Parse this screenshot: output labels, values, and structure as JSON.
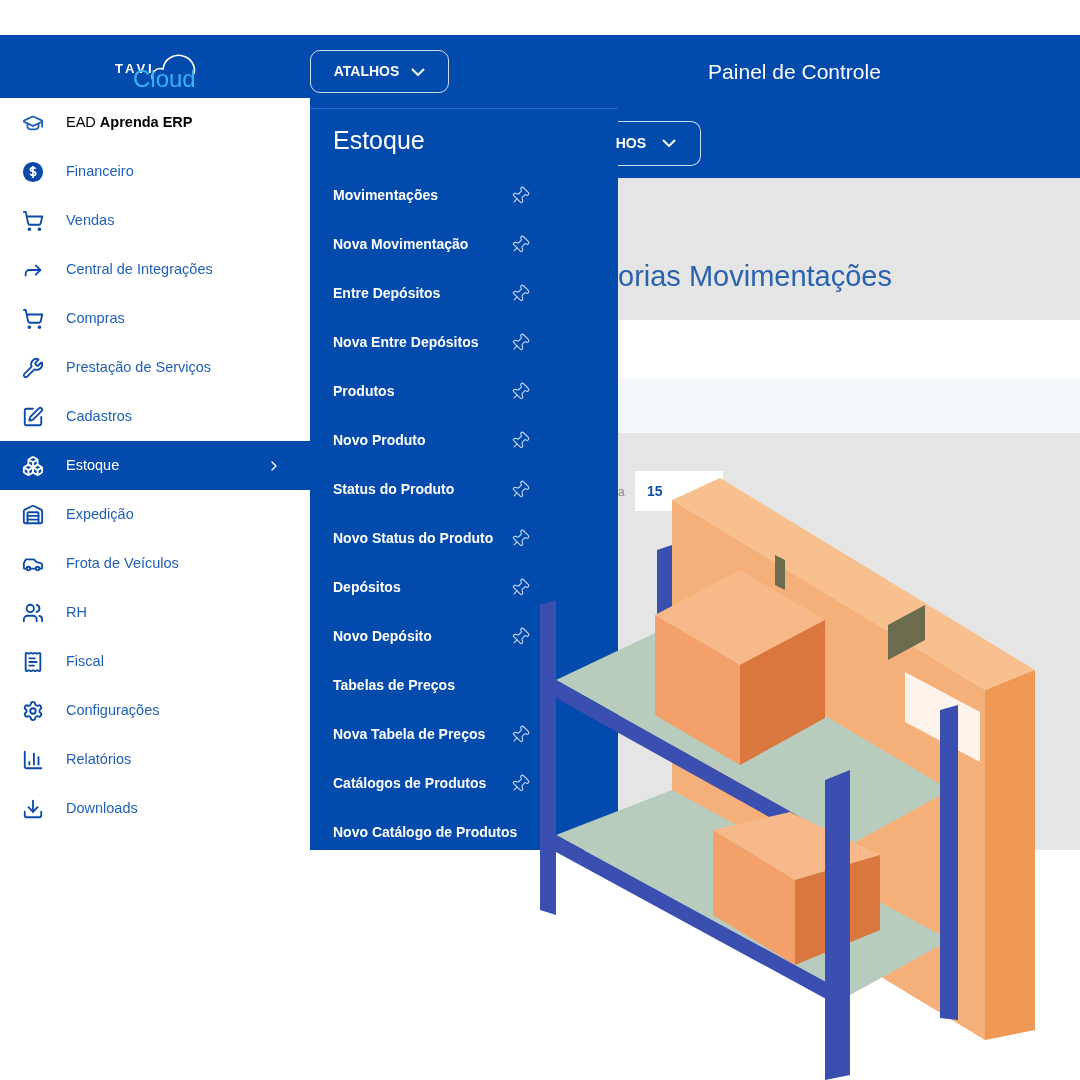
{
  "header": {
    "logo": {
      "top": "TAVI",
      "bottom": "Cloud"
    },
    "shortcuts_button": "ATALHOS",
    "title": "Painel de Controle"
  },
  "sidebar": {
    "items": [
      {
        "label": "EAD **Aprenda ERP**",
        "kind": "featured",
        "selected": false
      },
      {
        "label": "Financeiro",
        "kind": "module",
        "selected": false
      },
      {
        "label": "Vendas",
        "kind": "module",
        "selected": false
      },
      {
        "label": "Central de Integrações",
        "kind": "module",
        "selected": false
      },
      {
        "label": "Compras",
        "kind": "module",
        "selected": false
      },
      {
        "label": "Prestação de Serviços",
        "kind": "module",
        "selected": false
      },
      {
        "label": "Cadastros",
        "kind": "module",
        "selected": false
      },
      {
        "label": "Estoque",
        "kind": "module",
        "selected": true
      },
      {
        "label": "Expedição",
        "kind": "module",
        "selected": false
      },
      {
        "label": "Frota de Veículos",
        "kind": "module",
        "selected": false
      },
      {
        "label": "RH",
        "kind": "module",
        "selected": false
      },
      {
        "label": "Fiscal",
        "kind": "module",
        "selected": false
      },
      {
        "label": "Configurações",
        "kind": "module",
        "selected": false
      },
      {
        "label": "Relatórios",
        "kind": "module",
        "selected": false
      },
      {
        "label": "Downloads",
        "kind": "module",
        "selected": false
      }
    ]
  },
  "submenu": {
    "title": "Estoque",
    "items": [
      {
        "label": "Movimentações",
        "pin": true
      },
      {
        "label": "Nova Movimentação",
        "pin": true
      },
      {
        "label": "Entre Depósitos",
        "pin": true
      },
      {
        "label": "Nova Entre Depósitos",
        "pin": true
      },
      {
        "label": "Produtos",
        "pin": true
      },
      {
        "label": "Novo Produto",
        "pin": true
      },
      {
        "label": "Status do Produto",
        "pin": true
      },
      {
        "label": "Novo Status do Produto",
        "pin": true
      },
      {
        "label": "Depósitos",
        "pin": true
      },
      {
        "label": "Novo Depósito",
        "pin": true
      },
      {
        "label": "Tabelas de Preços",
        "pin": false
      },
      {
        "label": "Nova Tabela de Preços",
        "pin": true
      },
      {
        "label": "Catálogos de Produtos",
        "pin": true
      },
      {
        "label": "Novo Catálogo de Produtos",
        "pin": false
      }
    ]
  },
  "page_behind": {
    "button_fragment": "HOS",
    "heading_fragment": "orias Movimentações",
    "label_fragment": "a",
    "page_size": "15"
  }
}
